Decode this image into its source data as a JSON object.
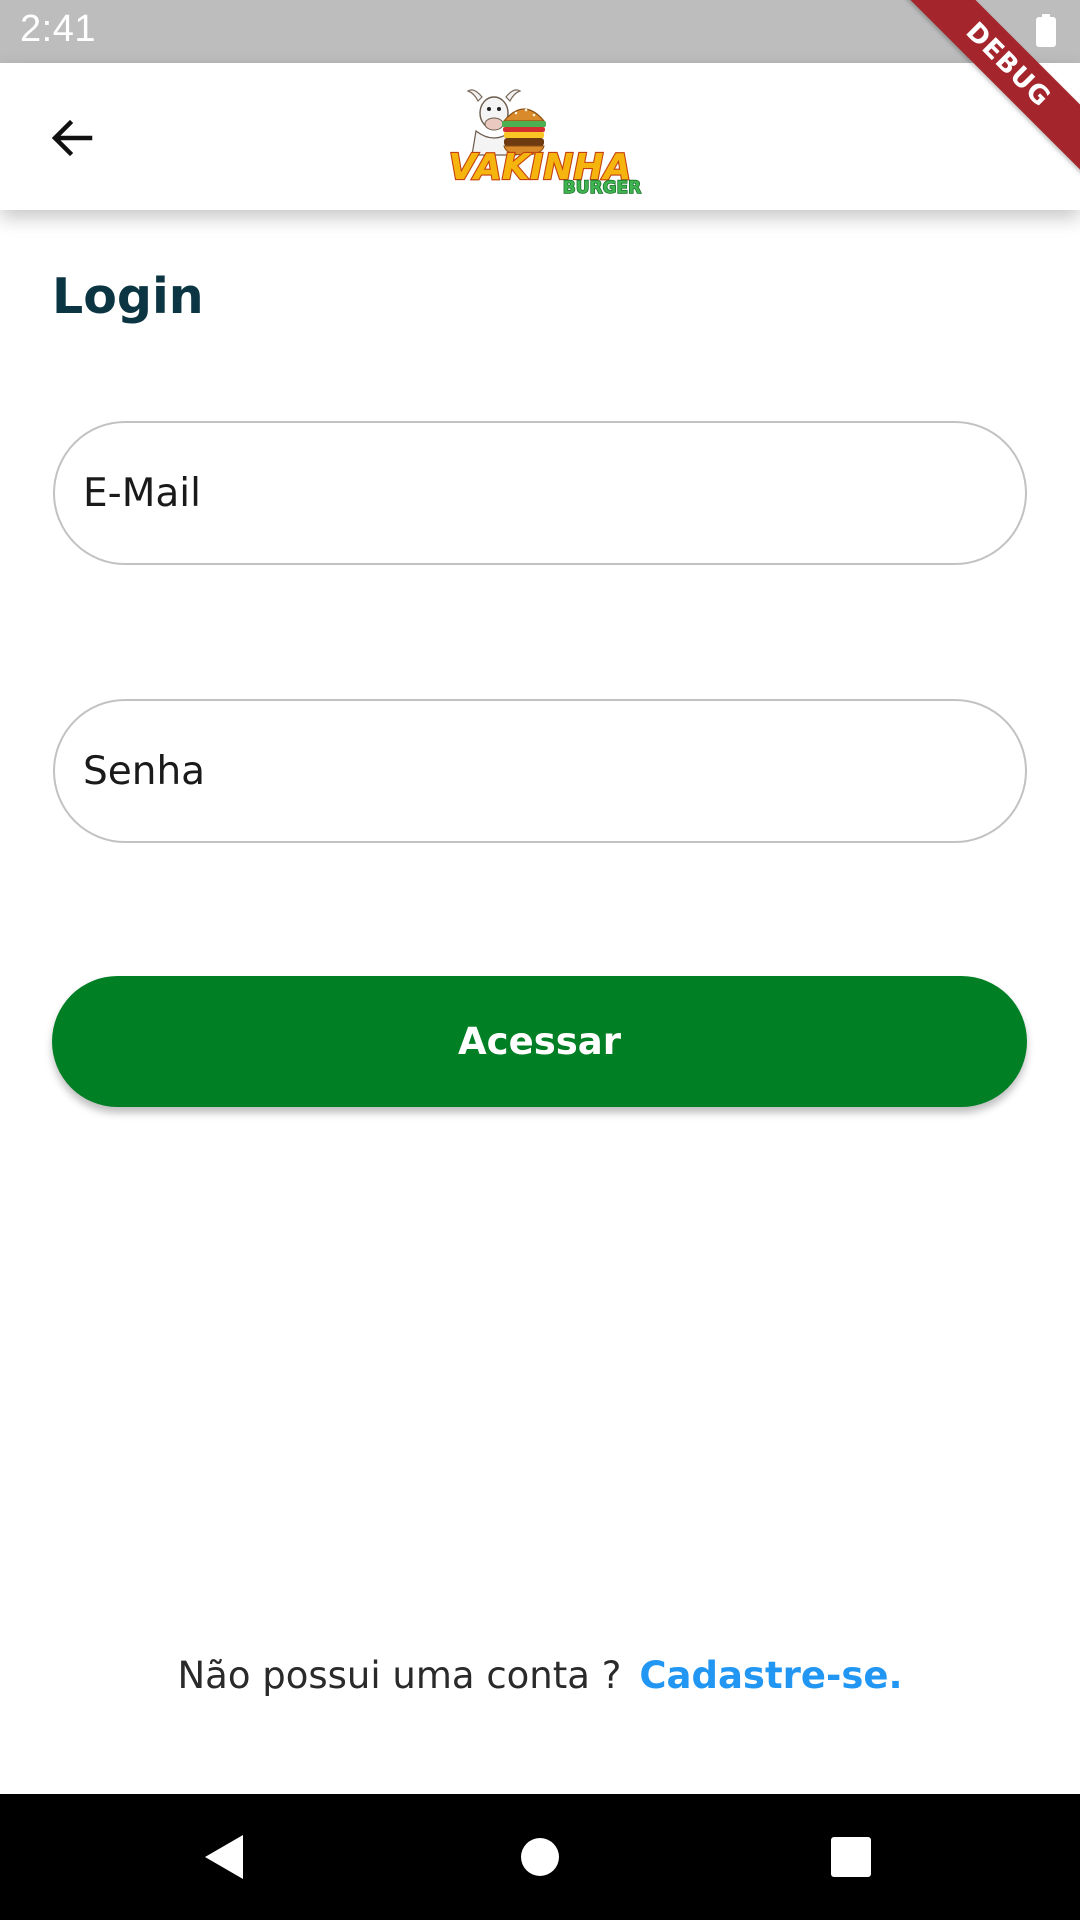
{
  "status_bar": {
    "time": "2:41",
    "icons": [
      "battery-icon"
    ]
  },
  "debug_banner": {
    "label": "DEBUG",
    "color": "#a4262c"
  },
  "app_bar": {
    "back_icon": "arrow-left-icon",
    "logo": {
      "wordmark": "VAKINHA",
      "sub_wordmark": "BURGER"
    }
  },
  "login": {
    "title": "Login",
    "email_placeholder": "E-Mail",
    "password_placeholder": "Senha",
    "submit_label": "Acessar"
  },
  "signup": {
    "prompt": "Não possui uma conta ?",
    "link_label": "Cadastre-se."
  },
  "nav_bar": {
    "icons": [
      "nav-back-icon",
      "nav-home-icon",
      "nav-recents-icon"
    ]
  },
  "colors": {
    "title": "#0b3542",
    "primary_button": "#007f24",
    "link": "#2196f3",
    "status_bar": "#bdbdbd",
    "nav_bar": "#000000"
  }
}
